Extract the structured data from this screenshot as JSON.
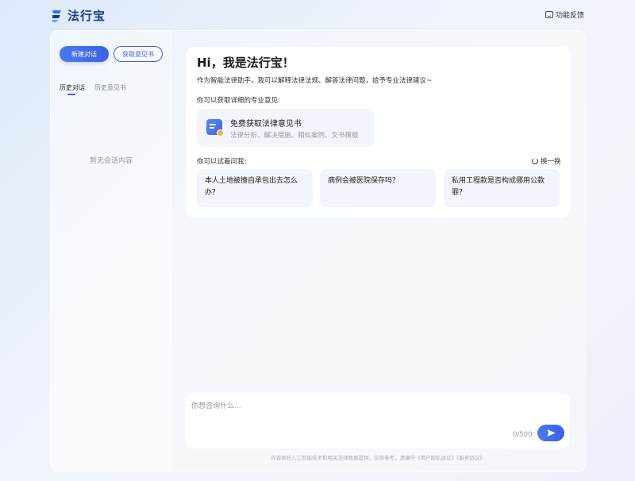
{
  "header": {
    "brand": "法行宝",
    "feedback_label": "功能反馈"
  },
  "sidebar": {
    "new_chat_label": "新建对话",
    "get_opinion_label": "获取意见书",
    "tabs": [
      {
        "label": "历史对话",
        "active": true
      },
      {
        "label": "历史意见书",
        "active": false
      }
    ],
    "empty_text": "暂无会话内容"
  },
  "welcome": {
    "title": "Hi，我是法行宝！",
    "intro": "作为智能法律助手，我可以解释法律法规、解答法律问题，给予专业法律建议~",
    "opinion_prompt": "你可以获取详细的专业意见:",
    "opinion_card": {
      "title": "免费获取法律意见书",
      "subtitle": "法律分析、解决措施、相似案例、文书模板"
    },
    "ask_prompt": "你可以试着问我:",
    "refresh_label": "换一换",
    "questions": [
      "本人土地被擅自承包出去怎么办？",
      "病例会被医院保存吗？",
      "私用工程款是否构成挪用公款罪？"
    ]
  },
  "composer": {
    "placeholder": "你想咨询什么...",
    "value": "",
    "counter": "0/500"
  },
  "footer": {
    "disclaimer": "内容依托人工智能技术和相关法律数据提供，仅供参考，请遵守《用户隐私协议》《服务协议》"
  },
  "colors": {
    "accent": "#3b62e6",
    "card_bg": "#f2f5fb"
  }
}
